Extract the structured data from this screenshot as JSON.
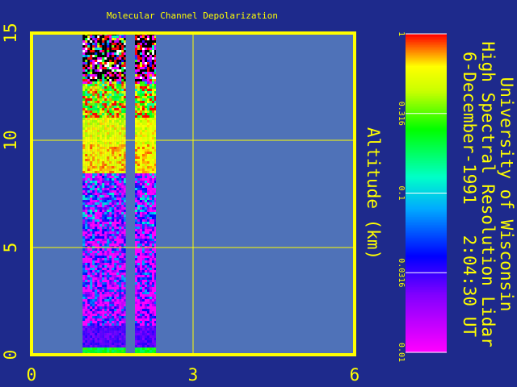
{
  "title": "Molecular Channel Depolarization",
  "ylabel": "Altitude (km)",
  "credit": {
    "line1": "University of Wisconsin",
    "line2": "High Spectral Resolution Lidar",
    "line3": "6-December-1991   2:04:30 UT"
  },
  "colors": {
    "background": "#1e2a8c",
    "plot_area": "#4f72b8",
    "frame": "#ffff00",
    "text": "#ffff00"
  },
  "chart_data": {
    "type": "heatmap",
    "title": "Molecular Channel Depolarization",
    "xlabel": "",
    "ylabel": "Altitude (km)",
    "xlim": [
      0,
      6
    ],
    "ylim": [
      0,
      15
    ],
    "x_ticks": [
      "0",
      "3",
      "6"
    ],
    "y_ticks": [
      "0",
      "5",
      "10",
      "15"
    ],
    "grid": true,
    "data_segments": [
      {
        "x_start": 0.95,
        "x_end": 1.75
      },
      {
        "x_start": 1.92,
        "x_end": 2.31
      }
    ],
    "profile_features": {
      "surface_return_top_km": 0.3,
      "high_depolarization_layer_top_km": 1.3,
      "cloud_base_km": 8.5,
      "cloud_peak_km": 11.5
    },
    "colorbar": {
      "scale": "log",
      "range": [
        0.01,
        1
      ],
      "ticks": [
        "1",
        "0.316",
        "0.1",
        "0.0316",
        "0.01"
      ]
    }
  }
}
